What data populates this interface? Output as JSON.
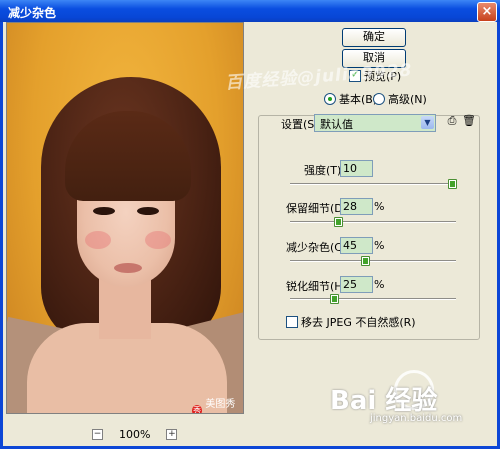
{
  "window": {
    "title": "减少杂色"
  },
  "buttons": {
    "ok": "确定",
    "cancel": "取消"
  },
  "preview_check": {
    "label": "预览(P)",
    "checked": true
  },
  "mode": {
    "basic": "基本(B)",
    "advanced": "高级(N)",
    "selected": "basic"
  },
  "settings": {
    "label": "设置(S):",
    "value": "默认值"
  },
  "sliders": [
    {
      "label": "强度(T):",
      "value": "10",
      "unit": "",
      "level": 1.0
    },
    {
      "label": "保留细节(D):",
      "value": "28",
      "unit": "%",
      "level": 0.28
    },
    {
      "label": "减少杂色(C):",
      "value": "45",
      "unit": "%",
      "level": 0.45
    },
    {
      "label": "锐化细节(H):",
      "value": "25",
      "unit": "%",
      "level": 0.25
    }
  ],
  "jpeg_check": {
    "label": "移去 JPEG 不自然感(R)",
    "checked": false
  },
  "zoom": {
    "value": "100%"
  },
  "watermarks": {
    "top": "百度经验@julia9928",
    "photo_logo": "美图秀秀",
    "baidu": "Bai  经验",
    "baidu_sub": "jingyan.baidu.com"
  },
  "icons": {
    "close": "close-icon",
    "save": "save-settings-icon",
    "delete": "trash-icon",
    "dropdown": "chevron-down-icon"
  }
}
